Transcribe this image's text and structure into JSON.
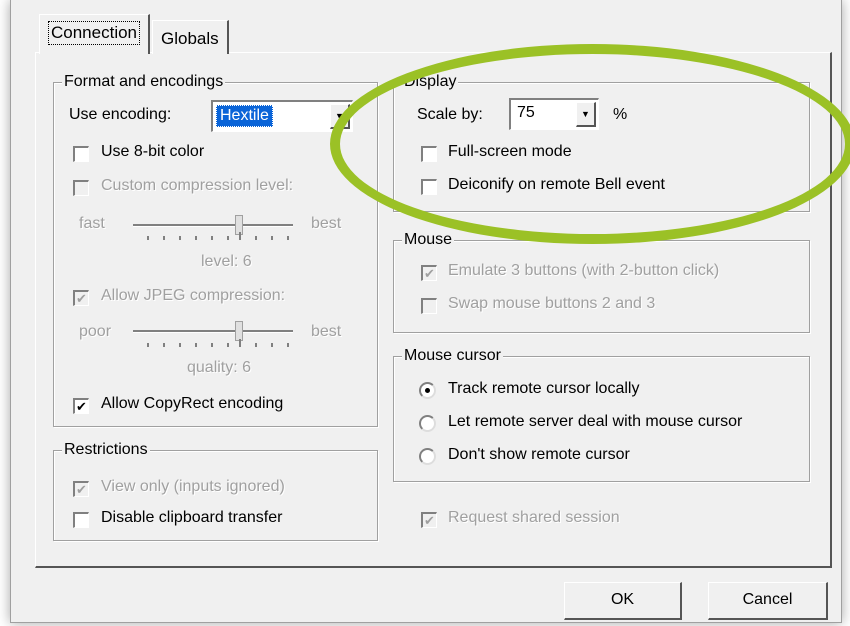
{
  "tabs": [
    {
      "label": "Connection",
      "active": true
    },
    {
      "label": "Globals",
      "active": false
    }
  ],
  "format": {
    "legend": "Format and encodings",
    "use_encoding_label": "Use encoding:",
    "encoding_value": "Hextile",
    "use_8bit_color": "Use 8-bit color",
    "custom_compression": "Custom compression level:",
    "fast": "fast",
    "best": "best",
    "level": "level: 6",
    "allow_jpeg": "Allow JPEG compression:",
    "poor": "poor",
    "best2": "best",
    "quality": "quality: 6",
    "allow_copyrect": "Allow CopyRect encoding",
    "checkbox_check": "✔"
  },
  "restrictions": {
    "legend": "Restrictions",
    "view_only": "View only (inputs ignored)",
    "disable_clipboard": "Disable clipboard transfer"
  },
  "display": {
    "legend": "Display",
    "scale_by": "Scale by:",
    "scale_value": "75",
    "percent": "%",
    "full_screen": "Full-screen mode",
    "deiconify": "Deiconify on remote Bell event"
  },
  "mouse": {
    "legend": "Mouse",
    "emulate3": "Emulate 3 buttons (with 2-button click)",
    "swap": "Swap mouse buttons 2 and 3"
  },
  "cursor": {
    "legend": "Mouse cursor",
    "track": "Track remote cursor locally",
    "let_server": "Let remote server deal with mouse cursor",
    "dont_show": "Don't show remote cursor"
  },
  "request_shared": "Request shared session",
  "buttons": {
    "ok": "OK",
    "cancel": "Cancel"
  },
  "colors": {
    "highlight": "#9bc126",
    "selection": "#0a64d8"
  }
}
